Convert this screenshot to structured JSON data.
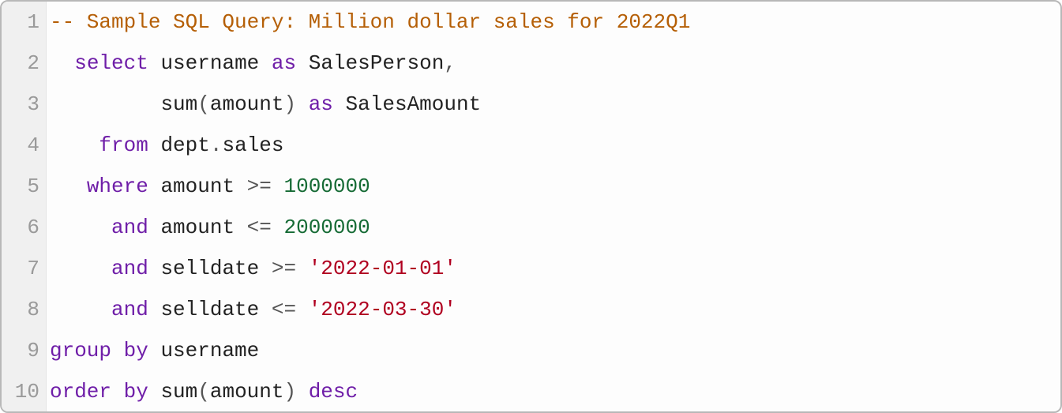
{
  "editor": {
    "language": "sql",
    "colors": {
      "comment": "#b55f06",
      "keyword": "#6f1ea8",
      "identifier": "#222222",
      "punctuation": "#555555",
      "number": "#166b35",
      "string": "#b00020",
      "gutter_bg": "#f0f0f0",
      "gutter_fg": "#9a9a9a",
      "border": "#b8b8b8"
    },
    "line_numbers": [
      "1",
      "2",
      "3",
      "4",
      "5",
      "6",
      "7",
      "8",
      "9",
      "10"
    ],
    "lines": [
      {
        "indent": "",
        "tokens": [
          {
            "t": "comment",
            "v": "-- Sample SQL Query: Million dollar sales for 2022Q1"
          }
        ]
      },
      {
        "indent": "  ",
        "tokens": [
          {
            "t": "keyword",
            "v": "select"
          },
          {
            "t": "space",
            "v": " "
          },
          {
            "t": "ident",
            "v": "username"
          },
          {
            "t": "space",
            "v": " "
          },
          {
            "t": "keyword",
            "v": "as"
          },
          {
            "t": "space",
            "v": " "
          },
          {
            "t": "ident",
            "v": "SalesPerson"
          },
          {
            "t": "punct",
            "v": ","
          }
        ]
      },
      {
        "indent": "         ",
        "tokens": [
          {
            "t": "func",
            "v": "sum"
          },
          {
            "t": "punct",
            "v": "("
          },
          {
            "t": "ident",
            "v": "amount"
          },
          {
            "t": "punct",
            "v": ")"
          },
          {
            "t": "space",
            "v": " "
          },
          {
            "t": "keyword",
            "v": "as"
          },
          {
            "t": "space",
            "v": " "
          },
          {
            "t": "ident",
            "v": "SalesAmount"
          }
        ]
      },
      {
        "indent": "    ",
        "tokens": [
          {
            "t": "keyword",
            "v": "from"
          },
          {
            "t": "space",
            "v": " "
          },
          {
            "t": "ident",
            "v": "dept"
          },
          {
            "t": "dot",
            "v": "."
          },
          {
            "t": "ident",
            "v": "sales"
          }
        ]
      },
      {
        "indent": "   ",
        "tokens": [
          {
            "t": "keyword",
            "v": "where"
          },
          {
            "t": "space",
            "v": " "
          },
          {
            "t": "ident",
            "v": "amount"
          },
          {
            "t": "space",
            "v": " "
          },
          {
            "t": "op",
            "v": ">="
          },
          {
            "t": "space",
            "v": " "
          },
          {
            "t": "number",
            "v": "1000000"
          }
        ]
      },
      {
        "indent": "     ",
        "tokens": [
          {
            "t": "keyword",
            "v": "and"
          },
          {
            "t": "space",
            "v": " "
          },
          {
            "t": "ident",
            "v": "amount"
          },
          {
            "t": "space",
            "v": " "
          },
          {
            "t": "op",
            "v": "<="
          },
          {
            "t": "space",
            "v": " "
          },
          {
            "t": "number",
            "v": "2000000"
          }
        ]
      },
      {
        "indent": "     ",
        "tokens": [
          {
            "t": "keyword",
            "v": "and"
          },
          {
            "t": "space",
            "v": " "
          },
          {
            "t": "ident",
            "v": "selldate"
          },
          {
            "t": "space",
            "v": " "
          },
          {
            "t": "op",
            "v": ">="
          },
          {
            "t": "space",
            "v": " "
          },
          {
            "t": "string",
            "v": "'2022-01-01'"
          }
        ]
      },
      {
        "indent": "     ",
        "tokens": [
          {
            "t": "keyword",
            "v": "and"
          },
          {
            "t": "space",
            "v": " "
          },
          {
            "t": "ident",
            "v": "selldate"
          },
          {
            "t": "space",
            "v": " "
          },
          {
            "t": "op",
            "v": "<="
          },
          {
            "t": "space",
            "v": " "
          },
          {
            "t": "string",
            "v": "'2022-03-30'"
          }
        ]
      },
      {
        "indent": "",
        "tokens": [
          {
            "t": "keyword",
            "v": "group by"
          },
          {
            "t": "space",
            "v": " "
          },
          {
            "t": "ident",
            "v": "username"
          }
        ]
      },
      {
        "indent": "",
        "tokens": [
          {
            "t": "keyword",
            "v": "order by"
          },
          {
            "t": "space",
            "v": " "
          },
          {
            "t": "func",
            "v": "sum"
          },
          {
            "t": "punct",
            "v": "("
          },
          {
            "t": "ident",
            "v": "amount"
          },
          {
            "t": "punct",
            "v": ")"
          },
          {
            "t": "space",
            "v": " "
          },
          {
            "t": "keyword",
            "v": "desc"
          }
        ]
      }
    ],
    "plain_text": "-- Sample SQL Query: Million dollar sales for 2022Q1\n  select username as SalesPerson,\n         sum(amount) as SalesAmount\n    from dept.sales\n   where amount >= 1000000\n     and amount <= 2000000\n     and selldate >= '2022-01-01'\n     and selldate <= '2022-03-30'\ngroup by username\norder by sum(amount) desc"
  }
}
